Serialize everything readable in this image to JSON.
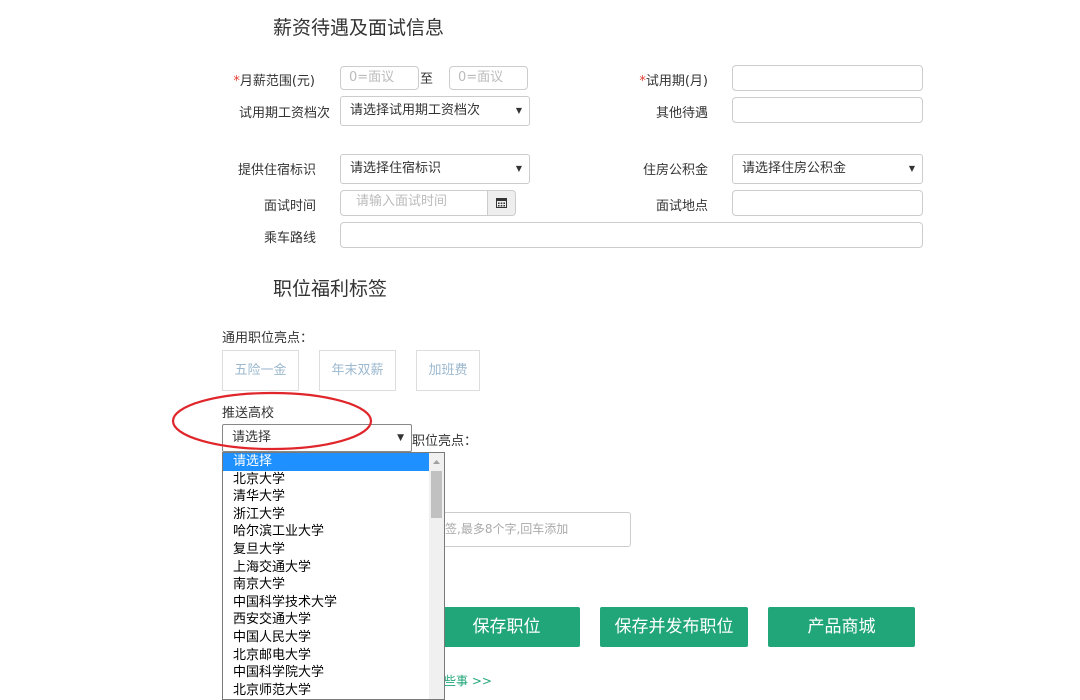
{
  "section1": {
    "title": "薪资待遇及面试信息"
  },
  "salary": {
    "required": "*",
    "label": "月薪范围(元)",
    "min_placeholder": "0=面议",
    "to": "至",
    "max_placeholder": "0=面议"
  },
  "trial": {
    "required": "*",
    "label": "试用期(月)",
    "value": ""
  },
  "trial_salary": {
    "label": "试用期工资档次",
    "value": "请选择试用期工资档次"
  },
  "other_benefits": {
    "label": "其他待遇",
    "value": ""
  },
  "housing": {
    "label": "提供住宿标识",
    "value": "请选择住宿标识"
  },
  "fund": {
    "label": "住房公积金",
    "value": "请选择住房公积金"
  },
  "interview_time": {
    "label": "面试时间",
    "placeholder": "请输入面试时间"
  },
  "interview_place": {
    "label": "面试地点",
    "value": ""
  },
  "route": {
    "label": "乘车路线",
    "value": ""
  },
  "section2": {
    "title": "职位福利标签"
  },
  "highlights": {
    "label": "通用职位亮点：",
    "tags": [
      "五险一金",
      "年末双薪",
      "加班费"
    ]
  },
  "push": {
    "label": "推送高校",
    "value": "请选择",
    "trailing": "职位亮点："
  },
  "custom_tag": {
    "placeholder": "签,最多8个字,回车添加"
  },
  "universities": [
    "请选择",
    "北京大学",
    "清华大学",
    "浙江大学",
    "哈尔滨工业大学",
    "复旦大学",
    "上海交通大学",
    "南京大学",
    "中国科学技术大学",
    "西安交通大学",
    "中国人民大学",
    "北京邮电大学",
    "中国科学院大学",
    "北京师范大学"
  ],
  "buttons": {
    "save": "保存职位",
    "save_publish": "保存并发布职位",
    "mall": "产品商城"
  },
  "footer_link": "些事 >>",
  "colors": {
    "accent": "#21a67a",
    "required": "#e23b30",
    "highlight": "#1e90ff",
    "annotation": "#e0262a"
  },
  "icons": {
    "calendar": "calendar-icon",
    "caret": "caret-down-icon"
  }
}
